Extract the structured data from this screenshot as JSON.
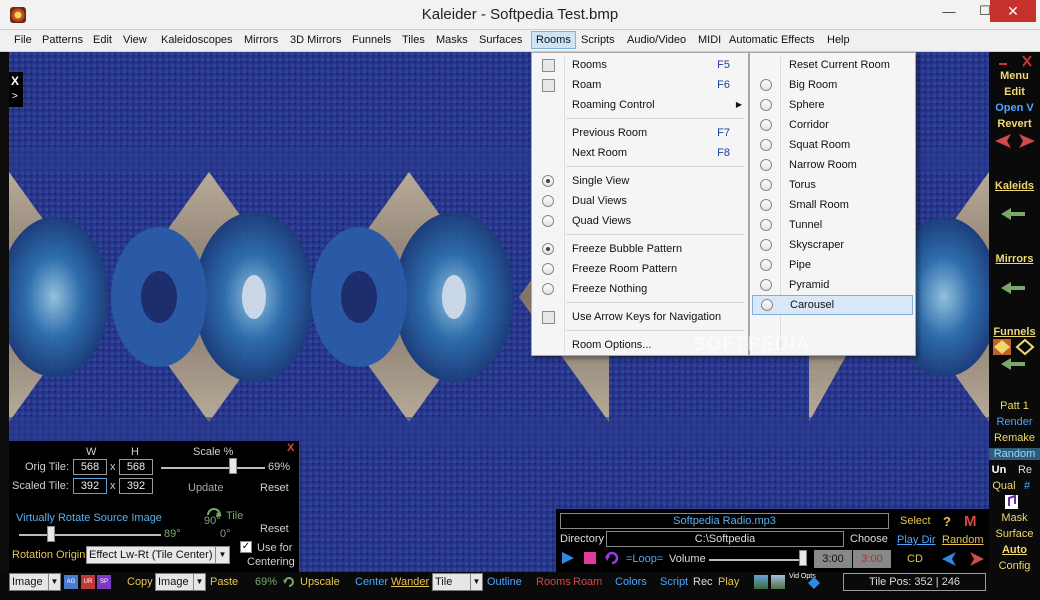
{
  "window": {
    "title": "Kaleider - Softpedia Test.bmp",
    "min": "—",
    "max": "☐",
    "close": "✕"
  },
  "menubar": [
    "File",
    "Patterns",
    "Edit",
    "View",
    "Kaleidoscopes",
    "Mirrors",
    "3D Mirrors",
    "Funnels",
    "Tiles",
    "Masks",
    "Surfaces",
    "Rooms",
    "Scripts",
    "Audio/Video",
    "MIDI",
    "Automatic Effects",
    "Help"
  ],
  "rooms_menu": {
    "items": [
      {
        "label": "Rooms",
        "shortcut": "F5",
        "kind": "check"
      },
      {
        "label": "Roam",
        "shortcut": "F6",
        "kind": "check"
      },
      {
        "label": "Roaming Control",
        "kind": "submenu"
      },
      {
        "label": "Previous Room",
        "shortcut": "F7"
      },
      {
        "label": "Next Room",
        "shortcut": "F8"
      },
      {
        "label": "Single View",
        "kind": "radio",
        "checked": true
      },
      {
        "label": "Dual Views",
        "kind": "radio"
      },
      {
        "label": "Quad Views",
        "kind": "radio"
      },
      {
        "label": "Freeze Bubble Pattern",
        "kind": "radio",
        "checked": true
      },
      {
        "label": "Freeze Room Pattern",
        "kind": "radio"
      },
      {
        "label": "Freeze Nothing",
        "kind": "radio"
      },
      {
        "label": "Use Arrow Keys for Navigation",
        "kind": "check"
      },
      {
        "label": "Room Options..."
      }
    ]
  },
  "room_types": [
    "Reset Current Room",
    "Big Room",
    "Sphere",
    "Corridor",
    "Squat Room",
    "Narrow Room",
    "Torus",
    "Small Room",
    "Tunnel",
    "Skyscraper",
    "Pipe",
    "Pyramid",
    "Carousel"
  ],
  "watermark": "SOFTPEDIA",
  "left_toolbar": {
    "close": "X",
    "expand": ">"
  },
  "right_panel": {
    "menu": "Menu",
    "edit": "Edit",
    "open": "Open V",
    "revert": "Revert",
    "kaleids": "Kaleids",
    "mirrors": "Mirrors",
    "funnels": "Funnels",
    "patt": "Patt 1",
    "render": "Render",
    "remake": "Remake",
    "random": "Random",
    "un": "Un",
    "re": "Re",
    "qual": "Qual",
    "hash": "#",
    "mask": "Mask",
    "surface": "Surface",
    "auto": "Auto",
    "config": "Config"
  },
  "tile_panel": {
    "w_label": "W",
    "h_label": "H",
    "scale_label": "Scale %",
    "close": "X",
    "orig_label": "Orig Tile:",
    "orig_w": "568",
    "orig_h": "568",
    "scaled_label": "Scaled Tile:",
    "scaled_w": "392",
    "scaled_h": "392",
    "x": "x",
    "scale_value": "69%",
    "scale_fraction": 0.69,
    "update": "Update",
    "reset": "Reset",
    "rotate_label": "Virtually Rotate Source Image",
    "rotate_value": "89°",
    "tile_rot_label": "Tile",
    "tile_rot_prefix": "90°",
    "tile_rot_value": "0°",
    "reset2": "Reset",
    "origin_label": "Rotation Origin",
    "origin_value": "Effect Lw-Rt (Tile Center)",
    "centering_use": "Use for",
    "centering": "Centering"
  },
  "audio_panel": {
    "file": "Softpedia Radio.mp3",
    "select": "Select",
    "dir_label": "Directory",
    "dir_value": "C:\\Softpedia",
    "choose": "Choose",
    "play_dir": "Play Dir",
    "random": "Random",
    "loop": "=Loop=",
    "volume": "Volume",
    "time1": "3:00",
    "time2": "3:00",
    "cd": "CD"
  },
  "bottom_bar": {
    "sel1": "Image",
    "copy": "Copy",
    "sel2": "Image",
    "paste": "Paste",
    "pct": "69%",
    "upscale": "Upscale",
    "center": "Center",
    "wander": "Wander",
    "sel3": "Tile",
    "outline": "Outline",
    "rooms": "Rooms",
    "roam": "Roam",
    "colors": "Colors",
    "script": "Script",
    "rec": "Rec",
    "play": "Play",
    "vid_ops": "Vid Opts",
    "tilepos": "Tile Pos:  352 | 246"
  },
  "colors": {
    "accent_yellow": "#e6c64c",
    "accent_blue": "#4da6ff",
    "menu_highlight": "#d9e8f8",
    "close_red": "#c7312b"
  }
}
